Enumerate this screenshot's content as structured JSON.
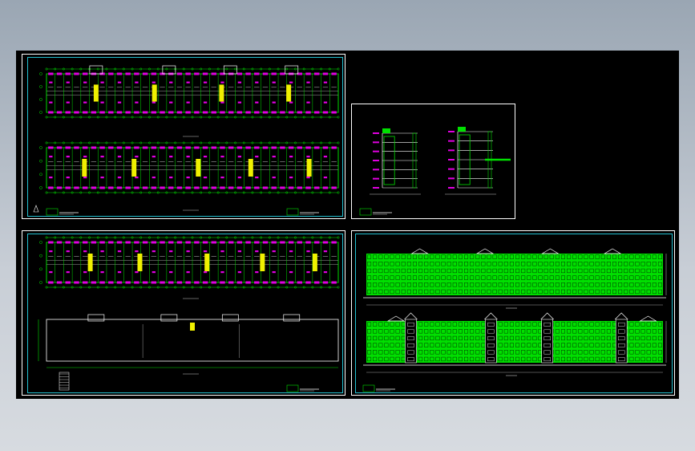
{
  "viewer": {
    "background": "#000000",
    "page_background": "#a7b1bc"
  },
  "colors": {
    "frame": "#ffffff",
    "inner_frame": "#22c0d0",
    "wall": "#00e000",
    "room_fill": "#e000e0",
    "highlight": "#f0f000",
    "axis": "#c8c8c8",
    "cyan": "#00c8c8"
  },
  "sheets": [
    {
      "id": "sheet-floor-plans-top",
      "kind": "floor-plans"
    },
    {
      "id": "sheet-sections",
      "kind": "sections"
    },
    {
      "id": "sheet-floor-plans-bottom",
      "kind": "floor-plan-and-roof"
    },
    {
      "id": "sheet-elevations",
      "kind": "elevations"
    }
  ],
  "icons": {
    "north-arrow": "north-arrow-icon",
    "title-block": "title-block-icon"
  }
}
